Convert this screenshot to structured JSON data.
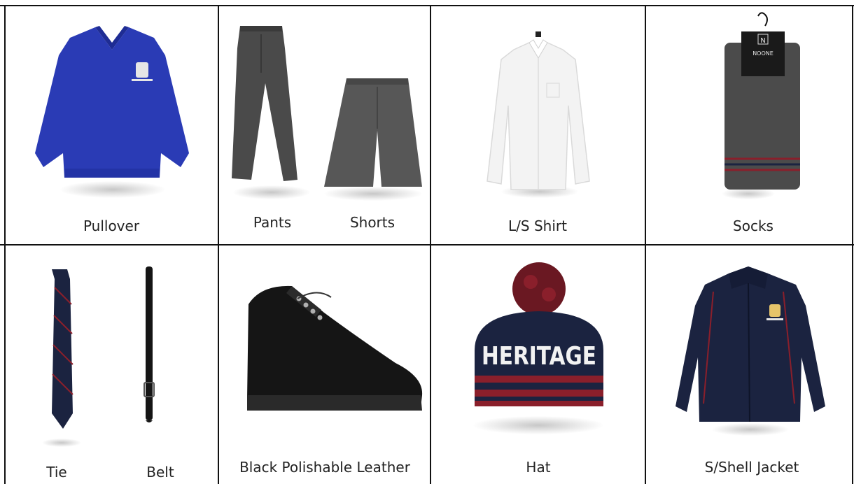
{
  "items": {
    "pullover": "Pullover",
    "pants": "Pants",
    "shorts": "Shorts",
    "ls_shirt": "L/S Shirt",
    "socks": "Socks",
    "tie": "Tie",
    "belt": "Belt",
    "shoes": "Black Polishable Leather",
    "hat": "Hat",
    "jacket": "S/Shell Jacket"
  },
  "product_text": {
    "hat_knit": "HERITAGE",
    "sock_brand": "NOONE",
    "sock_logo_letter": "N"
  },
  "colors": {
    "pullover": "#2a3bb5",
    "navy": "#1b2340",
    "maroon": "#8a1f2b",
    "grey_cloth": "#4a4a4a",
    "black": "#151515"
  }
}
